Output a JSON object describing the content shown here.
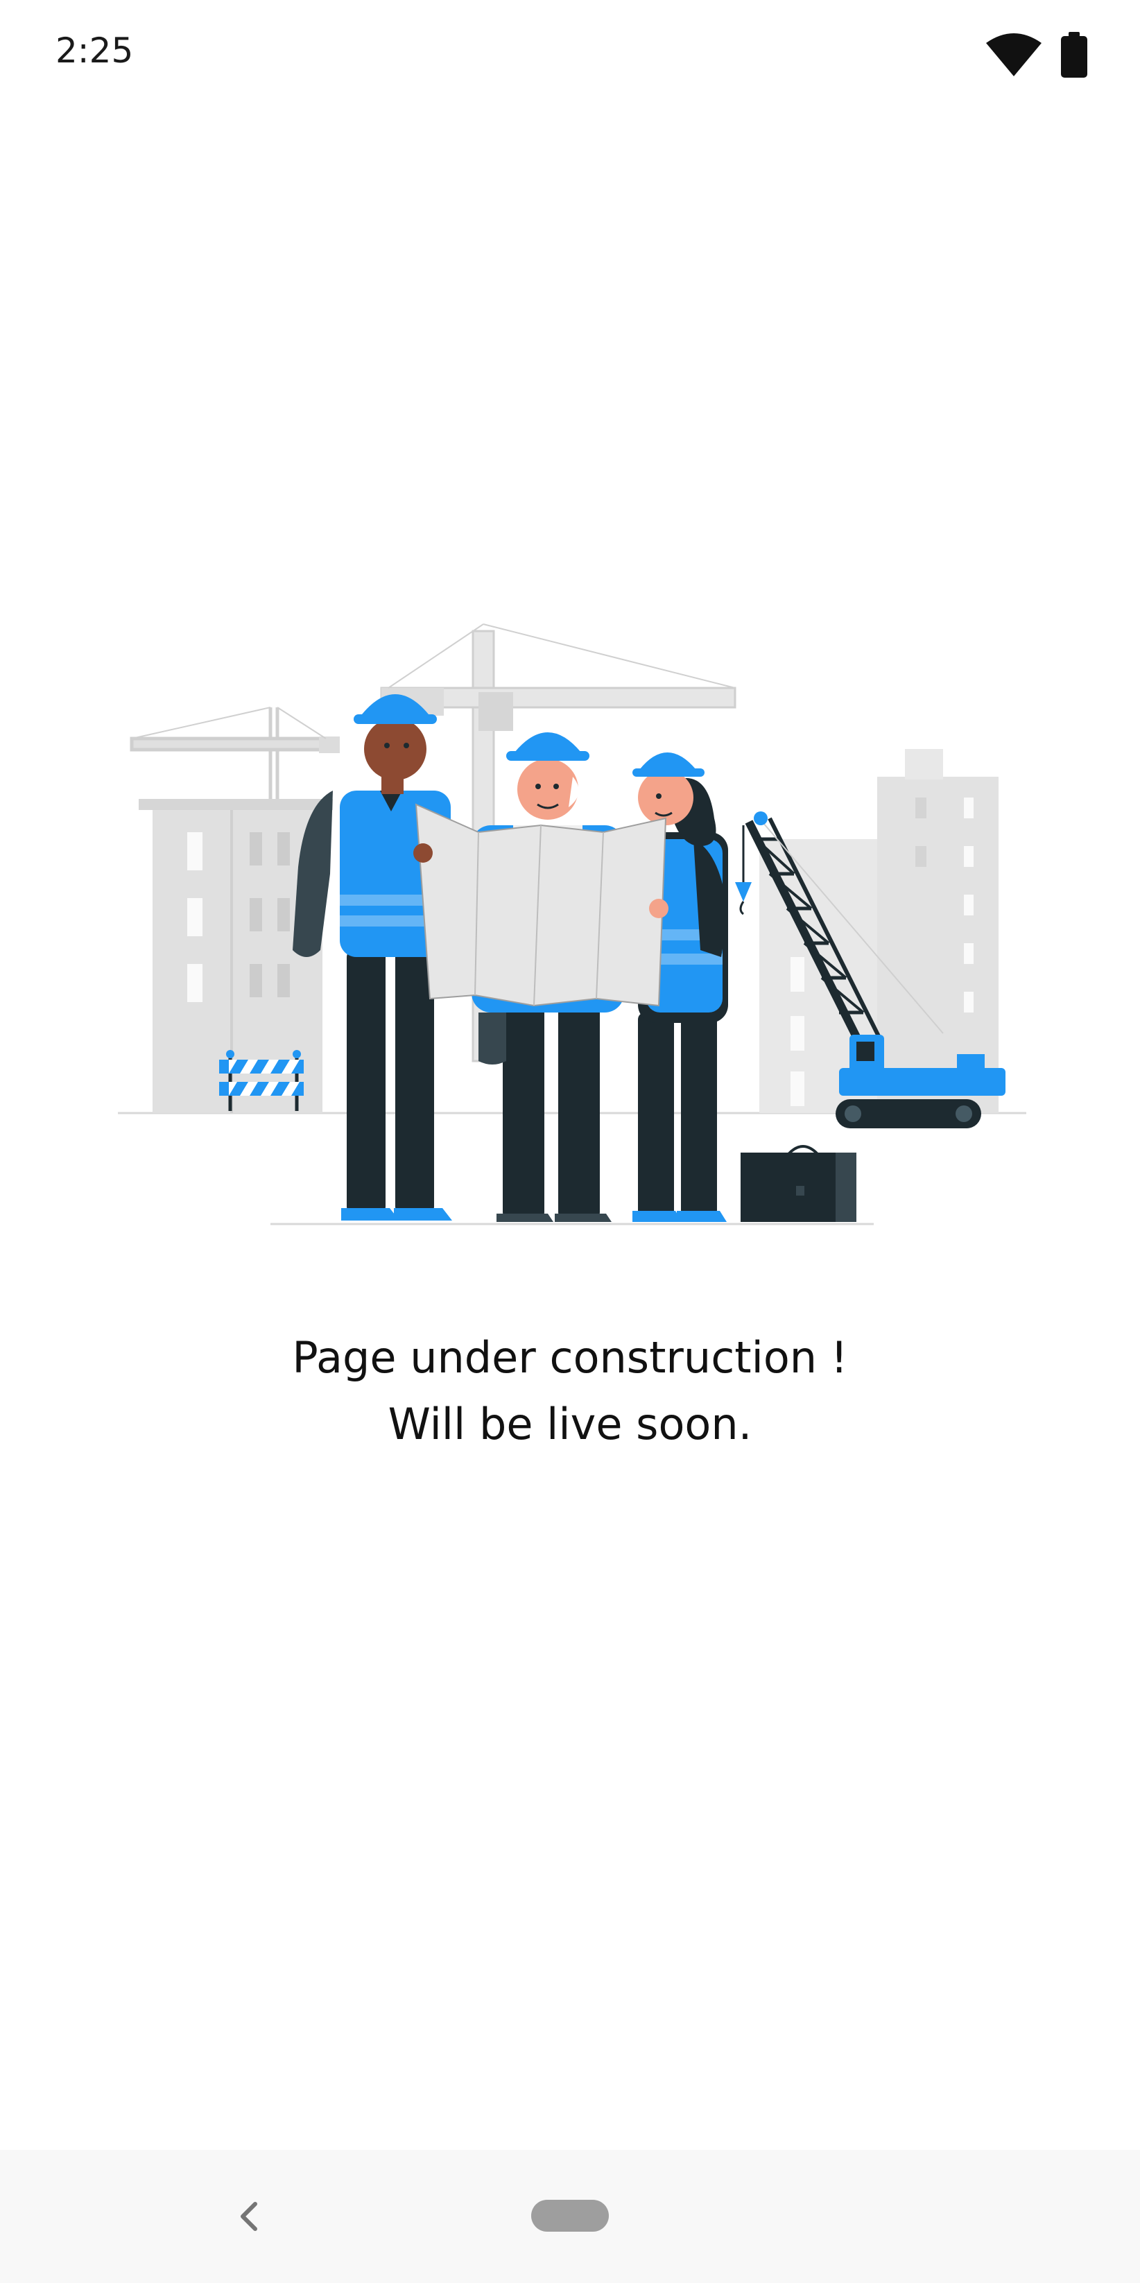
{
  "status_bar": {
    "time": "2:25",
    "icons": [
      "wifi-icon",
      "battery-icon"
    ]
  },
  "illustration": {
    "subject": "construction-workers-illustration"
  },
  "message": {
    "line1": "Page under construction !",
    "line2": "Will be live soon."
  },
  "nav_bar": {
    "icons": [
      "back-icon",
      "home-pill"
    ]
  },
  "colors": {
    "accent": "#2196f3",
    "dark": "#1d2a30",
    "building": "#e0e0e0",
    "text": "#111111",
    "nav_background": "#f8f8f8"
  }
}
